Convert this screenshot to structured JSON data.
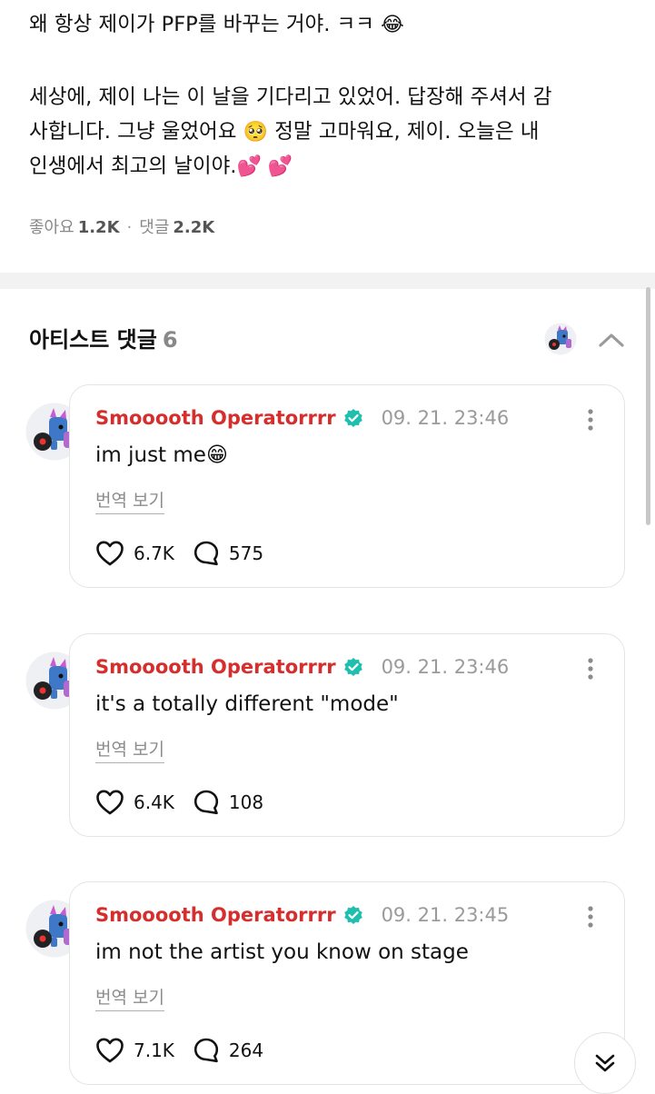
{
  "post": {
    "line1": "왜 항상 제이가 PFP를 바꾸는 거야. ㅋㅋ",
    "line1_emoji": "😂",
    "line2": "세상에, 제이 나는 이 날을 기다리고 있었어. 답장해 주셔서 감",
    "line3_a": "사합니다. 그냥 울었어요",
    "line3_emoji": "🥺",
    "line3_b": "정말 고마워요, 제이. 오늘은 내",
    "line4": "인생에서 최고의 날이야.",
    "line4_emoji": "💕 💕"
  },
  "stats": {
    "likes_label": "좋아요",
    "likes_value": "1.2K",
    "separator": "·",
    "comments_label": "댓글",
    "comments_value": "2.2K"
  },
  "section": {
    "title": "아티스트 댓글",
    "count": "6"
  },
  "comments": [
    {
      "author": "Smooooth Operatorrrr",
      "time": "09. 21. 23:46",
      "text": "im just me😁",
      "translate": "번역 보기",
      "likes": "6.7K",
      "replies": "575"
    },
    {
      "author": "Smooooth Operatorrrr",
      "time": "09. 21. 23:46",
      "text": "it's a totally different \"mode\"",
      "translate": "번역 보기",
      "likes": "6.4K",
      "replies": "108"
    },
    {
      "author": "Smooooth Operatorrrr",
      "time": "09. 21. 23:45",
      "text": "im not the artist you know on stage",
      "translate": "번역 보기",
      "likes": "7.1K",
      "replies": "264"
    }
  ],
  "icons": {
    "verified": "verified-badge-icon",
    "heart": "heart-icon",
    "comment": "comment-bubble-icon",
    "more": "more-vertical-icon",
    "collapse": "chevron-up-icon",
    "scroll_down": "double-chevron-down-icon"
  },
  "colors": {
    "author": "#d62d2d",
    "verified": "#1fbfb0",
    "muted": "#8c8c8c",
    "band": "#f2f2f2"
  }
}
